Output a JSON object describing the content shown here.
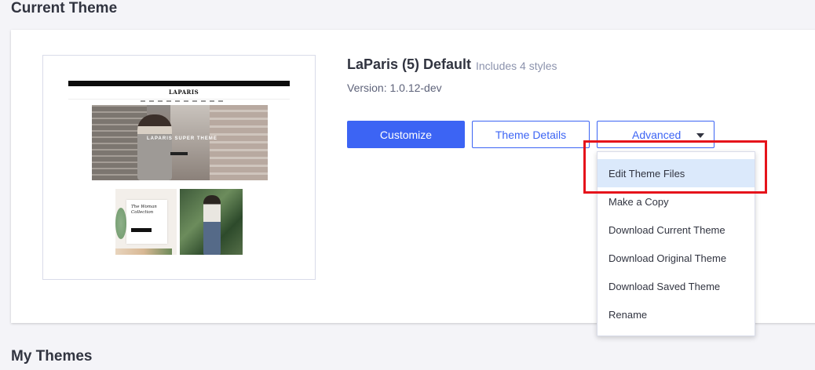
{
  "current_section": {
    "title": "Current Theme"
  },
  "theme": {
    "name": "LaParis (5) Default",
    "styles_note": "Includes 4 styles",
    "version": "Version: 1.0.12-dev",
    "preview": {
      "logo_text": "LAPARIS",
      "hero_text": "LAPARIS SUPER THEME",
      "card_title": "The Woman Collection"
    }
  },
  "actions": {
    "customize_label": "Customize",
    "details_label": "Theme Details",
    "advanced_label": "Advanced"
  },
  "advanced_menu": {
    "items": [
      {
        "label": "Edit Theme Files",
        "active": true
      },
      {
        "label": "Make a Copy"
      },
      {
        "label": "Download Current Theme"
      },
      {
        "label": "Download Original Theme"
      },
      {
        "label": "Download Saved Theme"
      },
      {
        "label": "Rename"
      }
    ]
  },
  "my_section": {
    "title": "My Themes"
  },
  "colors": {
    "primary": "#3c64f4",
    "highlight": "#e5131b",
    "menu_active": "#dbe9fb",
    "text": "#313440",
    "muted": "#8c93ad"
  }
}
